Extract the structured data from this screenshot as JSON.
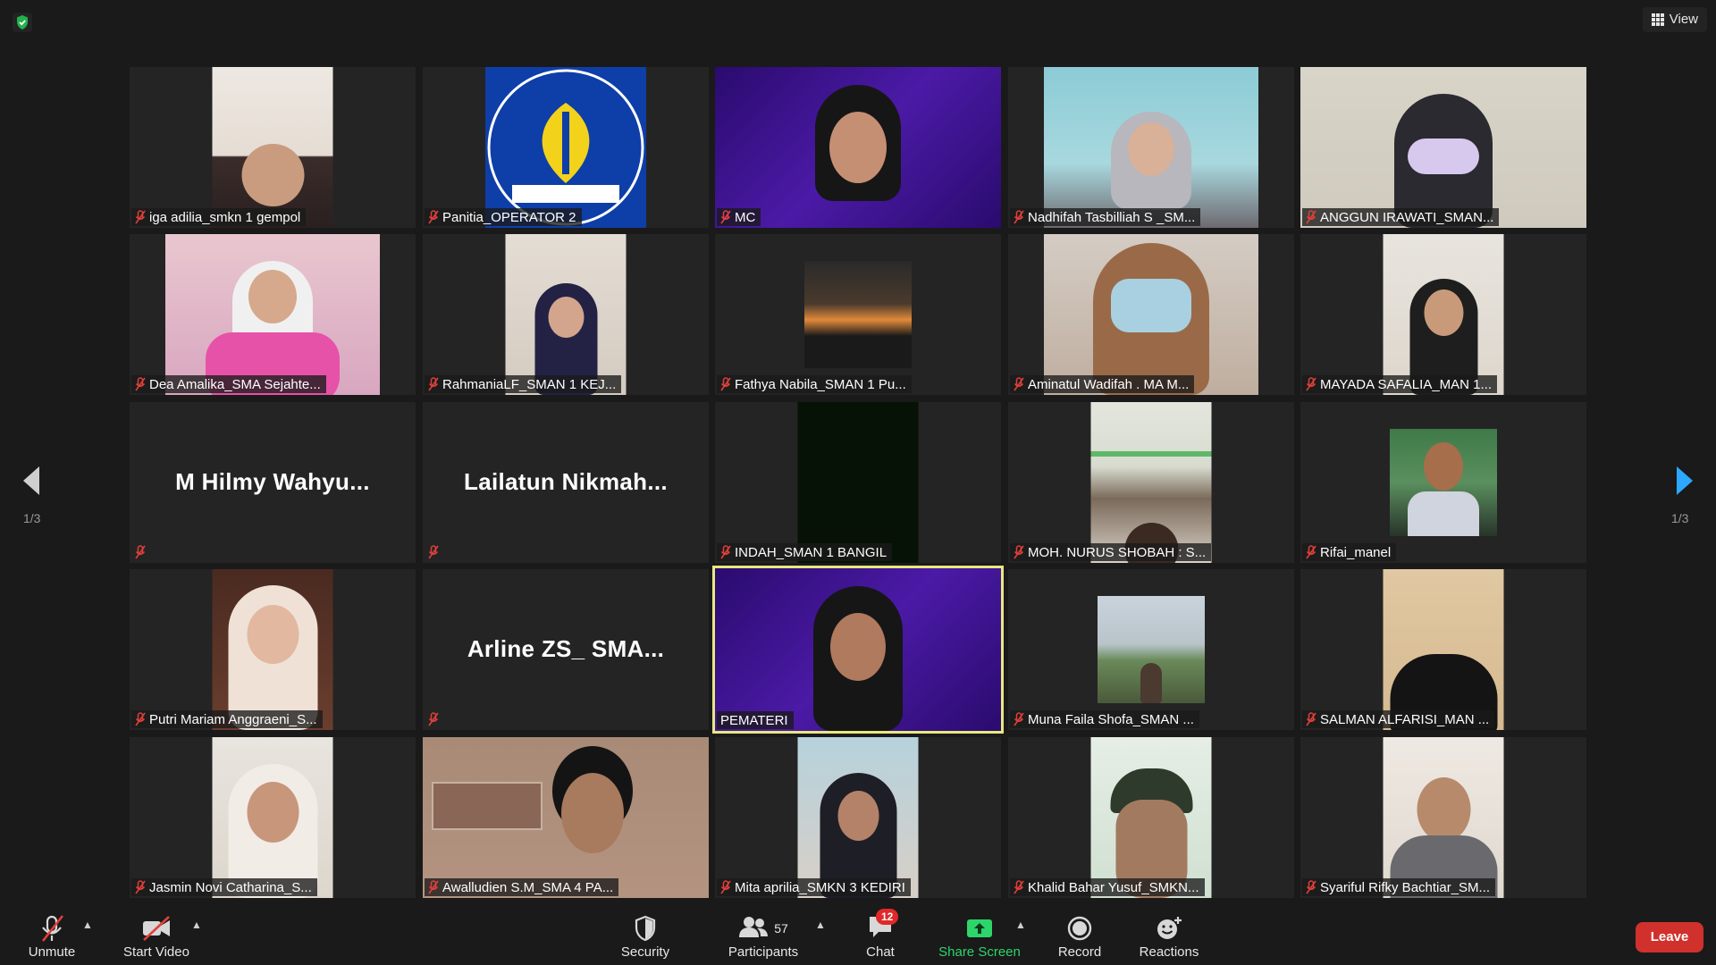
{
  "topbar": {
    "view_label": "View"
  },
  "pager": {
    "left_indicator": "1/3",
    "right_indicator": "1/3"
  },
  "tiles": [
    {
      "name": "iga adilia_smkn 1 gempol"
    },
    {
      "name": "Panitia_OPERATOR 2"
    },
    {
      "name": "MC"
    },
    {
      "name": "Nadhifah Tasbilliah S _SM..."
    },
    {
      "name": "ANGGUN IRAWATI_SMAN..."
    },
    {
      "name": "Dea Amalika_SMA Sejahte..."
    },
    {
      "name": "RahmaniaLF_SMAN 1 KEJ..."
    },
    {
      "name": "Fathya Nabila_SMAN 1 Pu..."
    },
    {
      "name": "Aminatul Wadifah . MA M..."
    },
    {
      "name": "MAYADA SAFALIA_MAN 1..."
    },
    {
      "big_name": "M  Hilmy  Wahyu..."
    },
    {
      "big_name": "Lailatun  Nikmah..."
    },
    {
      "name": "INDAH_SMAN 1 BANGIL"
    },
    {
      "name": "MOH. NURUS SHOBAH : S..."
    },
    {
      "name": "Rifai_manel"
    },
    {
      "name": "Putri Mariam Anggraeni_S..."
    },
    {
      "big_name": "Arline ZS_ SMA..."
    },
    {
      "name": "PEMATERI"
    },
    {
      "name": "Muna Faila Shofa_SMAN ..."
    },
    {
      "name": "SALMAN ALFARISI_MAN ..."
    },
    {
      "name": "Jasmin Novi Catharina_S..."
    },
    {
      "name": "Awalludien S.M_SMA 4 PA..."
    },
    {
      "name": "Mita aprilia_SMKN 3 KEDIRI"
    },
    {
      "name": "Khalid Bahar Yusuf_SMKN..."
    },
    {
      "name": "Syariful Rifky Bachtiar_SM..."
    }
  ],
  "toolbar": {
    "unmute_label": "Unmute",
    "start_video_label": "Start Video",
    "security_label": "Security",
    "participants_label": "Participants",
    "participants_count": "57",
    "chat_label": "Chat",
    "chat_badge": "12",
    "share_screen_label": "Share Screen",
    "record_label": "Record",
    "reactions_label": "Reactions",
    "leave_label": "Leave"
  },
  "colors": {
    "background": "#1a1a1a",
    "tile": "#242424",
    "active_speaker": "#e8e880",
    "share_green": "#2dd66a",
    "leave_red": "#d0312d",
    "muted_red": "#e0403a",
    "arrow_blue": "#2ea8ff"
  },
  "icons": [
    "shield-icon",
    "grid-icon",
    "mic-muted-icon",
    "video-off-icon",
    "security-shield-icon",
    "participants-icon",
    "chat-icon",
    "share-screen-icon",
    "record-icon",
    "reactions-icon",
    "arrow-left-icon",
    "arrow-right-icon"
  ]
}
